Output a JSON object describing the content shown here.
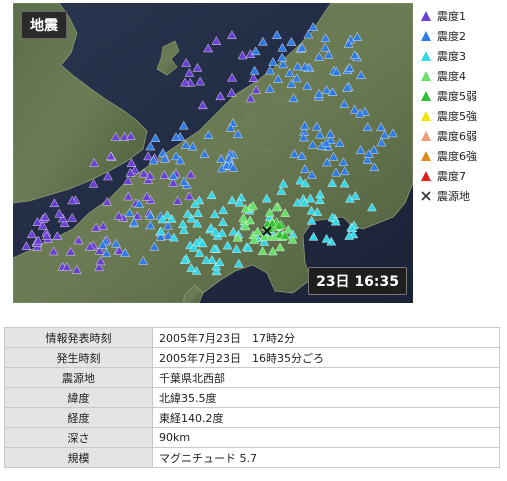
{
  "map": {
    "title": "地震",
    "time_label": "23日 16:35",
    "epicenter_symbol": "×"
  },
  "legend": [
    {
      "label": "震度1",
      "color": "#6a3fd6",
      "icon": "triangle-icon"
    },
    {
      "label": "震度2",
      "color": "#2f7be6",
      "icon": "triangle-icon"
    },
    {
      "label": "震度3",
      "color": "#33d6e6",
      "icon": "triangle-icon"
    },
    {
      "label": "震度4",
      "color": "#66e066",
      "icon": "triangle-icon"
    },
    {
      "label": "震度5弱",
      "color": "#2fbf2f",
      "icon": "triangle-icon"
    },
    {
      "label": "震度5強",
      "color": "#f2e600",
      "icon": "triangle-icon"
    },
    {
      "label": "震度6弱",
      "color": "#f09a7a",
      "icon": "triangle-icon"
    },
    {
      "label": "震度6強",
      "color": "#e08a1a",
      "icon": "triangle-icon"
    },
    {
      "label": "震度7",
      "color": "#e01e1e",
      "icon": "triangle-icon"
    },
    {
      "label": "震源地",
      "color": "#333333",
      "icon": "cross-icon"
    }
  ],
  "info": [
    {
      "label": "情報発表時刻",
      "value": "2005年7月23日　17時2分"
    },
    {
      "label": "発生時刻",
      "value": "2005年7月23日　16時35分ごろ"
    },
    {
      "label": "震源地",
      "value": "千葉県北西部"
    },
    {
      "label": "緯度",
      "value": "北緯35.5度"
    },
    {
      "label": "経度",
      "value": "東経140.2度"
    },
    {
      "label": "深さ",
      "value": "90km"
    },
    {
      "label": "規模",
      "value": "マグニチュード 5.7"
    }
  ]
}
